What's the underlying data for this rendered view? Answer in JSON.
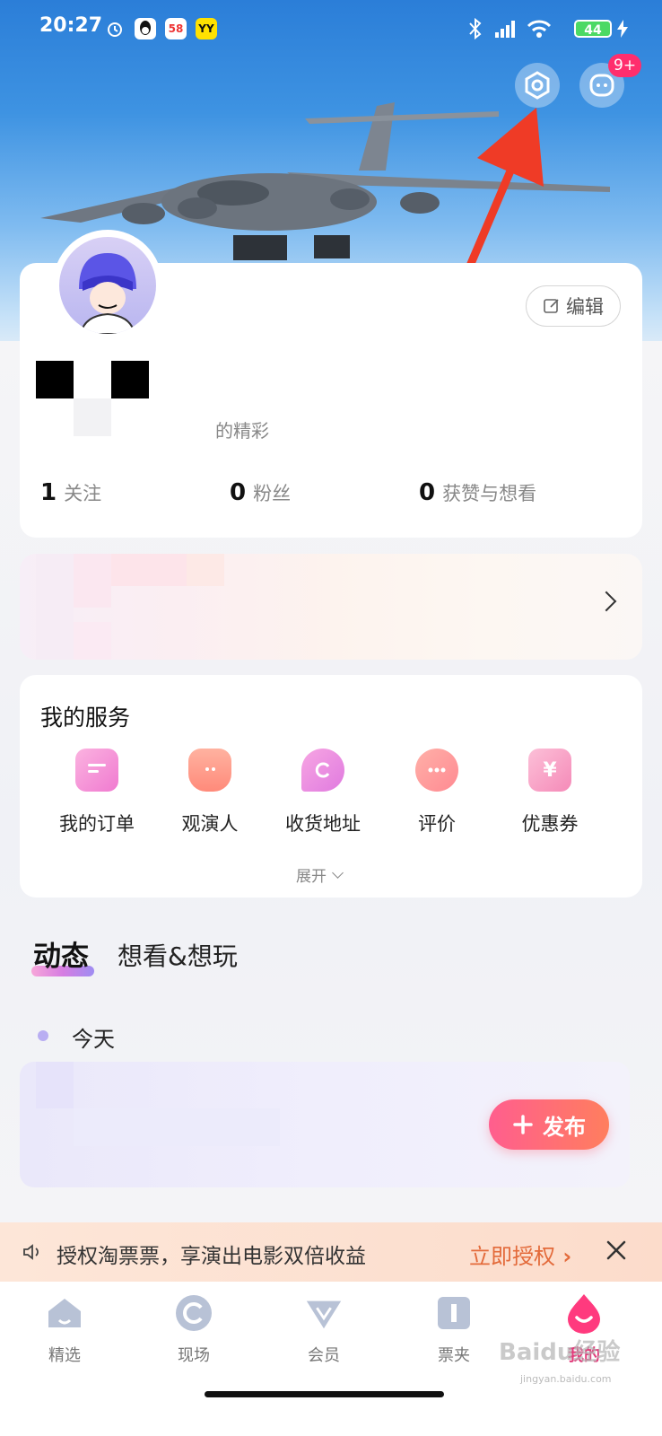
{
  "status_bar": {
    "time": "20:27",
    "battery": "44",
    "app_icons": [
      "alarm-icon",
      "qq-icon",
      "58-icon",
      "yy-icon"
    ]
  },
  "header": {
    "message_badge": "9+"
  },
  "profile": {
    "edit_label": "编辑",
    "bio_fragment": "的精彩",
    "stats": [
      {
        "count": "1",
        "label": "关注"
      },
      {
        "count": "0",
        "label": "粉丝"
      },
      {
        "count": "0",
        "label": "获赞与想看"
      }
    ]
  },
  "services": {
    "title": "我的服务",
    "items": [
      {
        "label": "我的订单",
        "icon": "order-icon"
      },
      {
        "label": "观演人",
        "icon": "audience-icon"
      },
      {
        "label": "收货地址",
        "icon": "address-icon"
      },
      {
        "label": "评价",
        "icon": "review-icon"
      },
      {
        "label": "优惠券",
        "icon": "coupon-icon"
      }
    ],
    "expand_label": "展开"
  },
  "feed": {
    "tabs": [
      "动态",
      "想看&想玩"
    ],
    "date_label": "今天",
    "publish_label": "发布"
  },
  "notice": {
    "text": "授权淘票票，享演出电影双倍收益",
    "cta": "立即授权"
  },
  "bottom_nav": [
    {
      "label": "精选",
      "icon": "home-icon"
    },
    {
      "label": "现场",
      "icon": "live-icon"
    },
    {
      "label": "会员",
      "icon": "vip-icon"
    },
    {
      "label": "票夹",
      "icon": "ticket-icon"
    },
    {
      "label": "我的",
      "icon": "profile-icon",
      "active": true
    }
  ],
  "watermark": {
    "text": "Baidu经验",
    "sub": "jingyan.baidu.com"
  },
  "colors": {
    "accent": "#e23a7a",
    "notice_cta": "#e36a3a",
    "publish_gradient": [
      "#ff5e8e",
      "#ff7e5e"
    ]
  }
}
